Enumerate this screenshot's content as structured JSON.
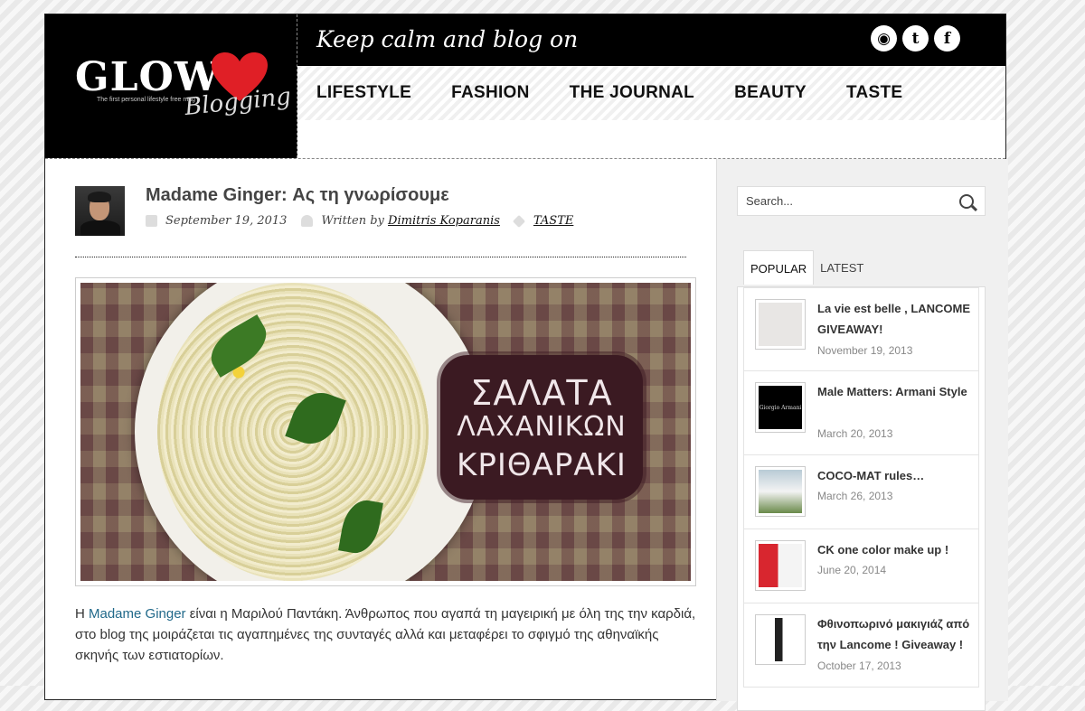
{
  "header": {
    "logo_main": "GLOW",
    "logo_script": "Blogging",
    "logo_tagline": "The first personal lifestyle free mag",
    "tagline": "Keep calm and blog on",
    "social": [
      "rss-icon",
      "twitter-icon",
      "facebook-icon"
    ]
  },
  "nav": {
    "items": [
      {
        "label": "LIFESTYLE"
      },
      {
        "label": "FASHION"
      },
      {
        "label": "THE JOURNAL"
      },
      {
        "label": "BEAUTY"
      },
      {
        "label": "TASTE"
      }
    ]
  },
  "post": {
    "title": "Madame Ginger: Ας τη γνωρίσουμε",
    "date": "September 19, 2013",
    "written_by": "Written by",
    "author": "Dimitris Koparanis",
    "category": "TASTE",
    "image_text": {
      "line1": "ΣΑΛΑΤΑ",
      "line2": "ΛΑΧΑΝΙΚΩΝ",
      "line3": "ΚΡΙΘΑΡΑΚΙ"
    },
    "body_prefix": "Η ",
    "body_link": "Madame Ginger",
    "body_rest": " είναι η Μαριλού Παντάκη. Άνθρωπος που αγαπά τη μαγειρική με όλη της την καρδιά, στο blog της μοιράζεται τις αγαπημένες της συνταγές αλλά και μεταφέρει το σφιγμό της αθηναϊκής σκηνής των εστιατορίων."
  },
  "sidebar": {
    "search_placeholder": "Search...",
    "tabs": [
      {
        "label": "POPULAR"
      },
      {
        "label": "LATEST"
      }
    ],
    "items": [
      {
        "title": "La vie est belle , LANCOME GIVEAWAY!",
        "date": "November 19, 2013",
        "thumb_color": "#e8e6e4"
      },
      {
        "title": "Male Matters: Armani Style",
        "date": "March 20, 2013",
        "thumb_color": "#000000",
        "thumb_text": "Giorgio Armani"
      },
      {
        "title": "COCO-MAT rules…",
        "date": "March 26, 2013",
        "thumb_color": "#9fb8c8"
      },
      {
        "title": "CK one color make up !",
        "date": "June 20, 2014",
        "thumb_color": "#d8262f"
      },
      {
        "title": "Φθινοπωρινό μακιγιάζ από την Lancome ! Giveaway !",
        "date": "October 17, 2013",
        "thumb_color": "#222222"
      }
    ]
  },
  "colors": {
    "link": "#21698a",
    "heart": "#e01f26",
    "badge": "#3b1a22"
  }
}
